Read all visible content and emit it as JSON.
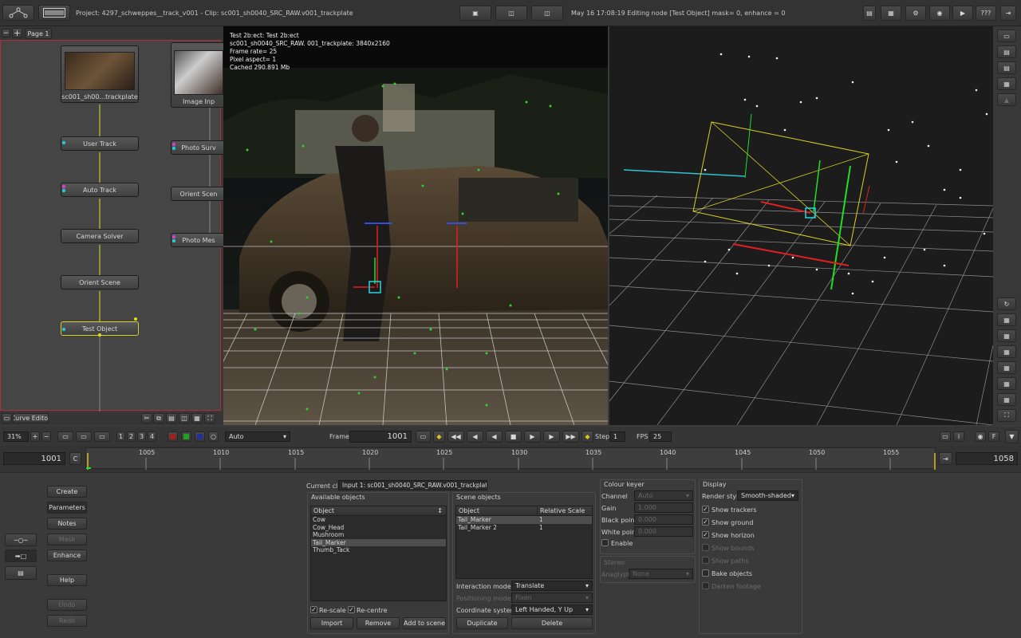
{
  "top_bar": {
    "project_info": "Project: 4297_schweppes__track_v001 - Clip: sc001_sh0040_SRC_RAW.v001_trackplate",
    "status": "May 16 17:08:19 Editing node [Test Object] mask= 0, enhance = 0",
    "help_label": "???"
  },
  "node_editor": {
    "page_tab": "Page 1",
    "nodes": {
      "clip": "sc001_sh00...trackplate",
      "image_input": "Image Inp",
      "user_track": "User Track",
      "auto_track": "Auto Track",
      "camera_solver": "Camera Solver",
      "orient_scene": "Orient Scene",
      "test_object": "Test Object",
      "photo_survey": "Photo Surv",
      "orient_scene_2": "Orient Scen",
      "photo_mesh": "Photo Mes"
    },
    "curve_editor_label": "Curve Editor"
  },
  "viewer": {
    "info_lines": [
      "Test 2b:ect: Test 2b:ect",
      "sc001_sh0040_SRC_RAW.  001_trackplate: 3840x2160",
      "Frame rate= 25",
      "Pixel aspect= 1",
      "Cached 290.891 Mb"
    ]
  },
  "viewer_controls": {
    "zoom": "31%",
    "pages": [
      "1",
      "2",
      "3",
      "4"
    ],
    "mode_select": "Auto",
    "frame_label": "Frame",
    "frame_value": "1001",
    "step_label": "Step",
    "step_value": "1",
    "fps_label": "FPS",
    "fps_value": "25"
  },
  "timeline": {
    "start": "1001",
    "end": "1058",
    "c_label": "C",
    "ticks": [
      "1005",
      "1010",
      "1015",
      "1020",
      "1025",
      "1030",
      "1035",
      "1040",
      "1045",
      "1050",
      "1055"
    ]
  },
  "side_buttons": [
    "Create",
    "Parameters",
    "Notes",
    "Mask",
    "Enhance",
    "Help",
    "Undo",
    "Redo"
  ],
  "params": {
    "current_clip_label": "Current clip",
    "current_clip_value": "Input 1: sc001_sh0040_SRC_RAW.v001_trackplate",
    "available_objects_label": "Available objects",
    "object_col": "Object",
    "available_objects": [
      "Cow",
      "Cow_Head",
      "Mushroom",
      "Tail_Marker",
      "Thumb_Tack"
    ],
    "re_scale": "Re-scale",
    "re_centre": "Re-centre",
    "import": "Import",
    "remove": "Remove",
    "add_to_scene": "Add to scene",
    "scene_objects_label": "Scene objects",
    "relative_scale_col": "Relative Scale",
    "scene_objects": [
      {
        "name": "Tail_Marker",
        "scale": "1"
      },
      {
        "name": "Tail_Marker 2",
        "scale": "1"
      }
    ],
    "interaction_mode_label": "Interaction mode:",
    "interaction_mode_value": "Translate",
    "positioning_mode_label": "Positioning mode:",
    "positioning_mode_value": "Fixen",
    "coord_system_label": "Coordinate system:",
    "coord_system_value": "Left Handed, Y Up",
    "duplicate": "Duplicate",
    "delete": "Delete",
    "colour_keyer_label": "Colour keyer",
    "channel_label": "Channel",
    "channel_value": "Auto",
    "gain_label": "Gain",
    "gain_value": "1.000",
    "black_point_label": "Black point",
    "black_point_value": "0.000",
    "white_point_label": "White point",
    "white_point_value": "0.000",
    "enable_label": "Enable",
    "stereo_label": "Stereo",
    "anaglyph_label": "Anaglyph",
    "anaglyph_value": "None",
    "display_label": "Display",
    "render_style_label": "Render style",
    "render_style_value": "Smooth-shaded",
    "show_trackers": "Show trackers",
    "show_ground": "Show ground",
    "show_horizon": "Show horizon",
    "show_bounds": "Show bounds",
    "show_paths": "Show paths",
    "bake_objects": "Bake objects",
    "darken_footage": "Darken footage"
  }
}
